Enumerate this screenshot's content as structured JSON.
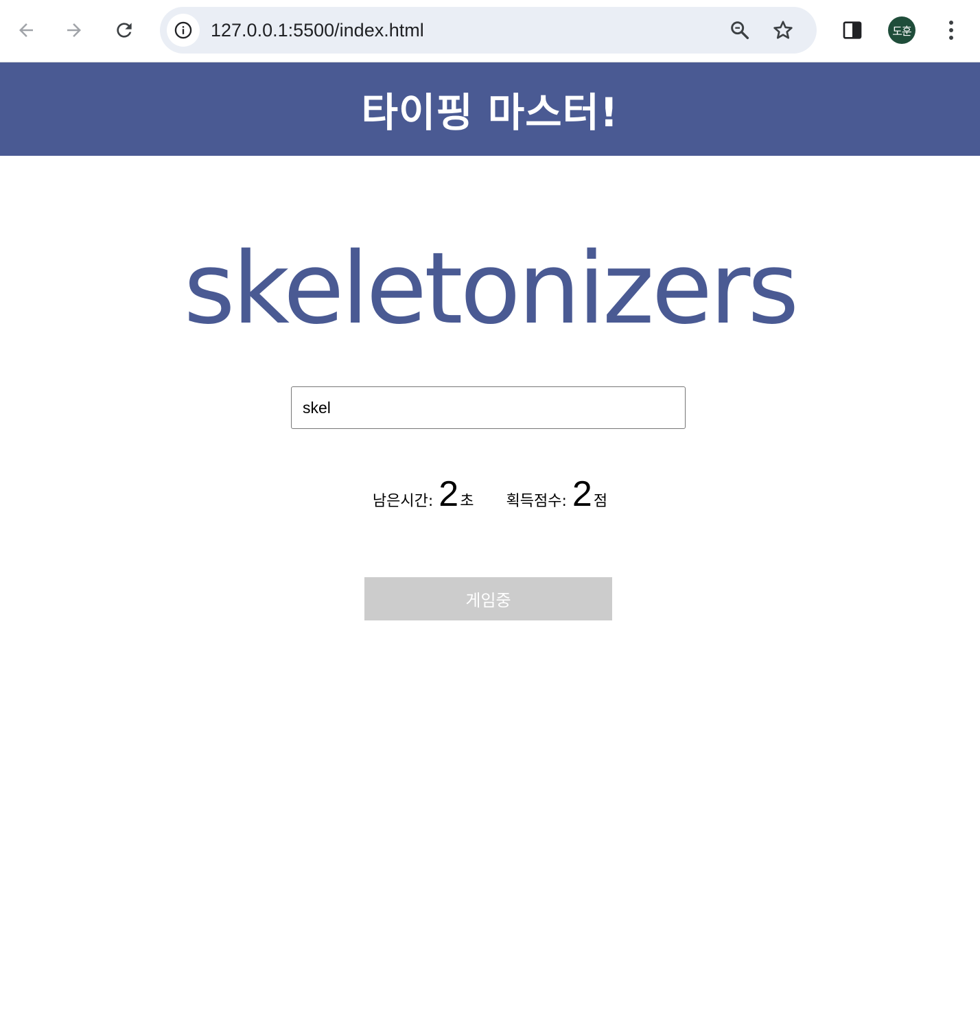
{
  "browser": {
    "url": "127.0.0.1:5500/index.html",
    "profile_initials": "도훈",
    "icons": {
      "back": "arrow-left-icon",
      "forward": "arrow-right-icon",
      "reload": "reload-icon",
      "site_info": "info-icon",
      "zoom": "magnifier-icon",
      "bookmark": "star-icon",
      "side_panel": "side-panel-icon",
      "menu": "kebab-menu-icon"
    }
  },
  "page": {
    "title": "타이핑 마스터!",
    "current_word": "skeletonizers",
    "input_value": "skel",
    "stats": {
      "time_label": "남은시간:",
      "time_value": "2",
      "time_unit": "초",
      "score_label": "획득점수:",
      "score_value": "2",
      "score_unit": "점"
    },
    "button_label": "게임중"
  },
  "colors": {
    "brand": "#4a5a93",
    "button_disabled": "#cccccc",
    "avatar_bg": "#1f4d3a",
    "omnibox_bg": "#eaeef5"
  }
}
